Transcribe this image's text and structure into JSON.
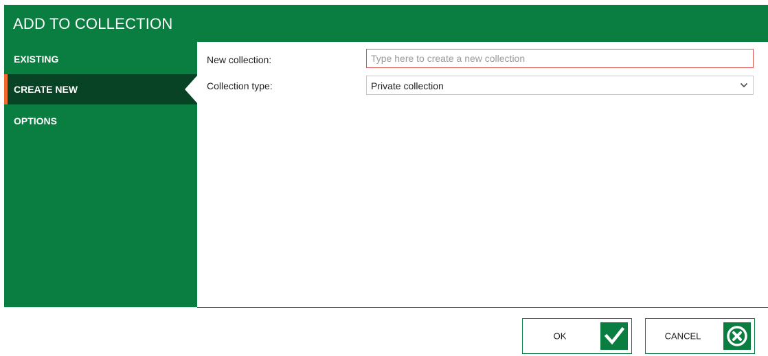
{
  "dialog": {
    "title": "ADD TO COLLECTION"
  },
  "sidebar": {
    "items": [
      {
        "label": "EXISTING",
        "selected": false
      },
      {
        "label": "CREATE NEW",
        "selected": true
      },
      {
        "label": "OPTIONS",
        "selected": false
      }
    ]
  },
  "form": {
    "new_collection_label": "New collection:",
    "new_collection_placeholder": "Type here to create a new collection",
    "new_collection_value": "",
    "collection_type_label": "Collection type:",
    "collection_type_value": "Private collection"
  },
  "footer": {
    "ok_label": "OK",
    "cancel_label": "CANCEL"
  },
  "icons": {
    "ok": "checkmark-icon",
    "cancel": "close-circle-icon",
    "dropdown": "chevron-down-icon"
  },
  "colors": {
    "brand_green": "#0a7d40",
    "selected_nav": "#074324",
    "accent_orange": "#f26a2b",
    "input_error_border": "#d9534f"
  }
}
